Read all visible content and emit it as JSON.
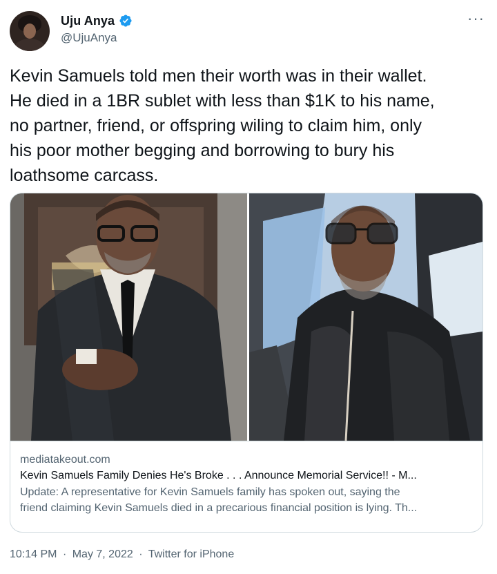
{
  "author": {
    "display_name": "Uju Anya",
    "handle": "@UjuAnya",
    "verified": true
  },
  "menu": {
    "more_glyph": "···"
  },
  "tweet": {
    "text": "Kevin Samuels told men their worth was in their wallet.\nHe died in a 1BR sublet with less than $1K to his name,\nno partner, friend, or offspring wiling to claim him, only\nhis poor mother begging and borrowing to bury his\nloathsome carcass."
  },
  "link_card": {
    "domain": "mediatakeout.com",
    "title": "Kevin Samuels Family Denies He's Broke . . . Announce Memorial Service!! - M...",
    "description_line1": "Update: A representative for Kevin Samuels family has spoken out, saying the",
    "description_line2": "friend claiming Kevin Samuels died in a precarious financial position is lying. Th..."
  },
  "footer": {
    "time": "10:14 PM",
    "separator1": "·",
    "date": "May 7, 2022",
    "separator2": "·",
    "source": "Twitter for iPhone"
  },
  "colors": {
    "verified_badge": "#1d9bf0",
    "secondary_text": "#536471",
    "border": "#cfd9de"
  }
}
